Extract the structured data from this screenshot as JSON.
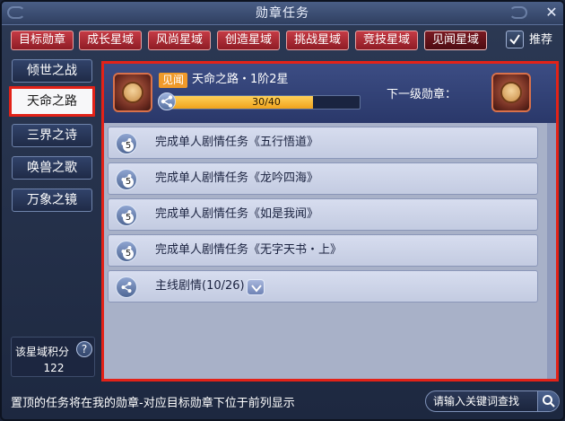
{
  "window": {
    "title": "勋章任务",
    "close_label": "✕"
  },
  "tabs": [
    {
      "label": "目标勋章"
    },
    {
      "label": "成长星域"
    },
    {
      "label": "风尚星域"
    },
    {
      "label": "创造星域"
    },
    {
      "label": "挑战星域"
    },
    {
      "label": "竞技星域"
    },
    {
      "label": "见闻星域",
      "active": true
    }
  ],
  "recommend": {
    "label": "推荐",
    "checked": true
  },
  "sidebar": {
    "items": [
      {
        "label": "倾世之战"
      },
      {
        "label": "天命之路",
        "active": true
      },
      {
        "label": "三界之诗"
      },
      {
        "label": "唤兽之歌"
      },
      {
        "label": "万象之镜"
      }
    ],
    "score_label": "该星域积分",
    "score_value": "122",
    "help_label": "?"
  },
  "header": {
    "rank_badge": "见闻",
    "medal_name": "天命之路・1阶2星",
    "progress_text": "30/40",
    "progress_fraction": 0.75,
    "next_medal_label": "下一级勋章："
  },
  "tasks": [
    {
      "text": "完成单人剧情任务《五行悟道》",
      "count": "5"
    },
    {
      "text": "完成单人剧情任务《龙吟四海》",
      "count": "5"
    },
    {
      "text": "完成单人剧情任务《如是我闻》",
      "count": "5"
    },
    {
      "text": "完成单人剧情任务《无字天书・上》",
      "count": "5"
    },
    {
      "text": "主线剧情(10/26)",
      "count": "",
      "expandable": true
    }
  ],
  "footer": {
    "hint": "置顶的任务将在我的勋章-对应目标勋章下位于前列显示",
    "search_placeholder": "请输入关键词查找"
  },
  "colors": {
    "accent_red": "#e32218",
    "tab_red": "#b02a34",
    "progress_gold": "#f0a31c",
    "badge_orange": "#f09a2a"
  }
}
